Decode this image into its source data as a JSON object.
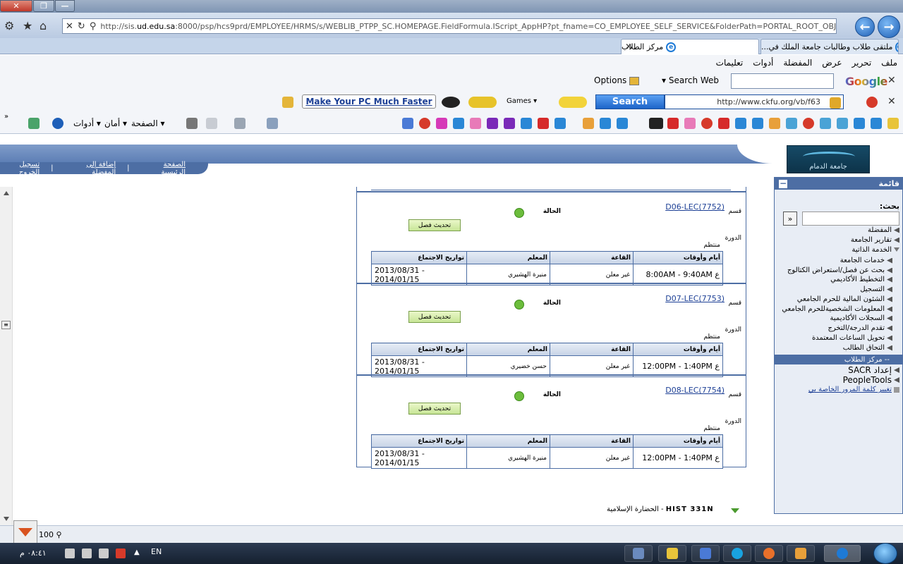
{
  "browser": {
    "address_url_prefix": "http://sis.",
    "address_url_domain": "ud.edu.sa",
    "address_url_rest": ":8000/psp/hcs9prd/EMPLOYEE/HRMS/s/WEBLIB_PTPP_SC.HOMEPAGE.FieldFormula.IScript_AppHP?pt_fname=CO_EMPLOYEE_SELF_SERVICE&FolderPath=PORTAL_ROOT_OBJ",
    "tab_active": "مركز الطلاب",
    "tab_other": "ملتقى طلاب وطالبات جامعة الملك في...",
    "menu": [
      "ملف",
      "تحرير",
      "عرض",
      "المفضلة",
      "أدوات",
      "تعليمات"
    ],
    "google_logo": "Google",
    "search_web": "Search Web",
    "options": "Options",
    "search_button": "Search",
    "ckfu_url": "http://www.ckfu.org/vb/f63",
    "make_pc_faster": "Make Your PC Much Faster",
    "games": "Games",
    "cmd_page": "الصفحة",
    "cmd_safety": "أمان",
    "cmd_tools": "أدوات",
    "zoom": "100"
  },
  "portal": {
    "nav": {
      "home": "الصفحة الرئيسية",
      "add_fav": "إضافة إلى المفضلة",
      "logout": "تسجيل الخروج"
    },
    "logo_text": "جامعة الدمام"
  },
  "sidemenu": {
    "title": "قائمة",
    "search_label": "بحث:",
    "go": "«",
    "items": [
      "المفضلة",
      "تقارير الجامعة",
      "الخدمة الذاتية"
    ],
    "subitems": [
      "خدمات الجامعة",
      "بحث عن فصل/استعراض الكتالوج",
      "التخطيط الأكاديمي",
      "التسجيل",
      "الشئون المالية للحرم الجامعي",
      "المعلومات الشخصيةللحرم الجامعي",
      "السجلات الأكاديمية",
      "تقدم الدرجة/التخرج",
      "تحويل الساعات المعتمدة",
      "التحاق الطالب"
    ],
    "active": "-- مركز الطلاب",
    "extra": [
      "إعداد SACR",
      "PeopleTools"
    ],
    "change_password": "تغيير كلمة المرور الخاصة بي"
  },
  "labels": {
    "section": "قسم",
    "status": "الحالة",
    "update_class": "تحديث فصل",
    "session": "الدورة",
    "regular": "منتظم",
    "headers": [
      "أيام وأوقات",
      "القاعة",
      "المعلم",
      "تواريخ الاجتماع"
    ]
  },
  "sections": [
    {
      "code": "D06-LEC(7752)",
      "days": "ع",
      "time": "8:00AM - 9:40AM",
      "room": "غير معلن",
      "instructor": "منيرة الهشيري",
      "dates1": "2013/08/31 -",
      "dates2": "2014/01/15"
    },
    {
      "code": "D07-LEC(7753)",
      "days": "ع",
      "time": "12:00PM - 1:40PM",
      "room": "غير معلن",
      "instructor": "حسن خضيري",
      "dates1": "2013/08/31 -",
      "dates2": "2014/01/15"
    },
    {
      "code": "D08-LEC(7754)",
      "days": "ع",
      "time": "12:00PM - 1:40PM",
      "room": "غير معلن",
      "instructor": "منيرة الهشيري",
      "dates1": "2013/08/31 -",
      "dates2": "2014/01/15"
    }
  ],
  "next_course": {
    "code": "HIST  331N",
    "name": "الحضارة الإسلامية"
  },
  "taskbar": {
    "clock": "٠٨:٤١ م",
    "lang": "EN"
  }
}
